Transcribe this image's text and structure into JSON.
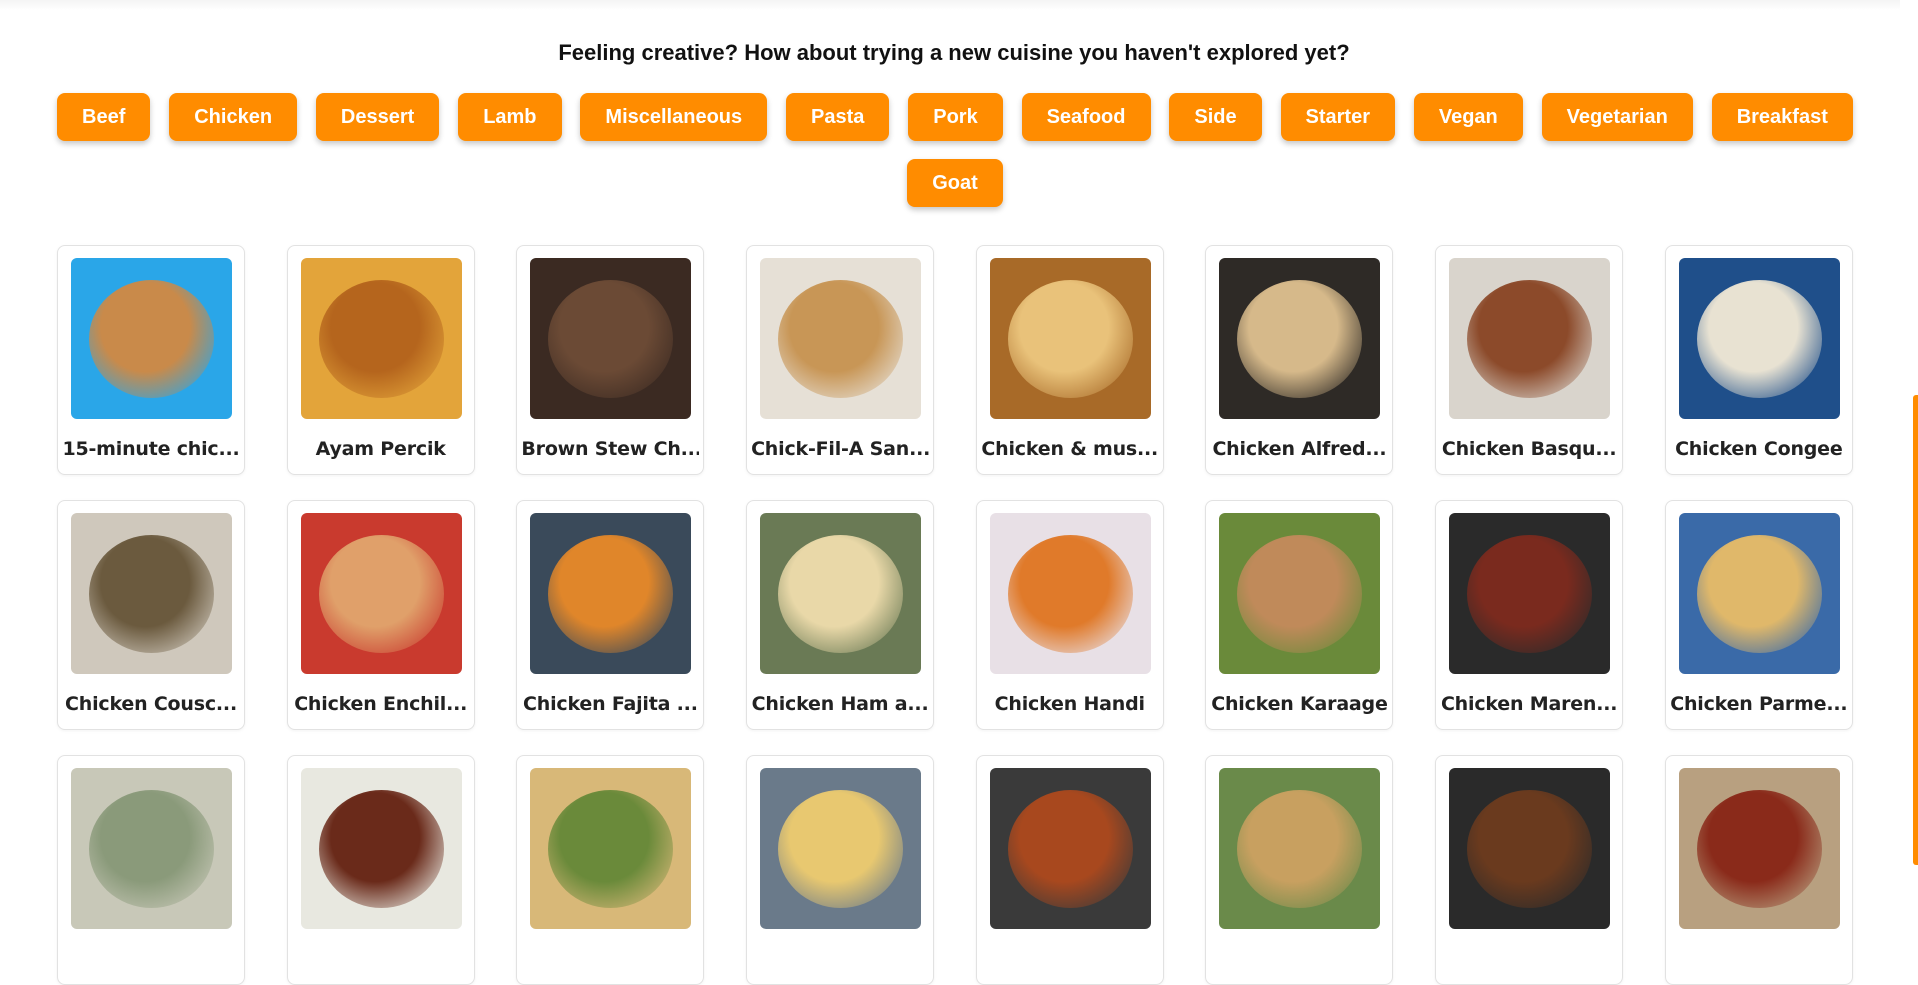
{
  "heading": "Feeling creative? How about trying a new cuisine you haven't explored yet?",
  "categories": [
    "Beef",
    "Chicken",
    "Dessert",
    "Lamb",
    "Miscellaneous",
    "Pasta",
    "Pork",
    "Seafood",
    "Side",
    "Starter",
    "Vegan",
    "Vegetarian",
    "Breakfast",
    "Goat"
  ],
  "meals": [
    "15-minute chic...",
    "Ayam Percik",
    "Brown Stew Ch...",
    "Chick-Fil-A San...",
    "Chicken & mus...",
    "Chicken Alfred...",
    "Chicken Basqu...",
    "Chicken Congee",
    "Chicken Cousc...",
    "Chicken Enchil...",
    "Chicken Fajita ...",
    "Chicken Ham a...",
    "Chicken Handi",
    "Chicken Karaage",
    "Chicken Maren...",
    "Chicken Parme...",
    "",
    "",
    "",
    "",
    "",
    "",
    "",
    ""
  ],
  "colors": {
    "accent": "#ff8c00",
    "button_text": "#ffffff",
    "heading_text": "#111111",
    "card_border": "#e2e2e2"
  }
}
